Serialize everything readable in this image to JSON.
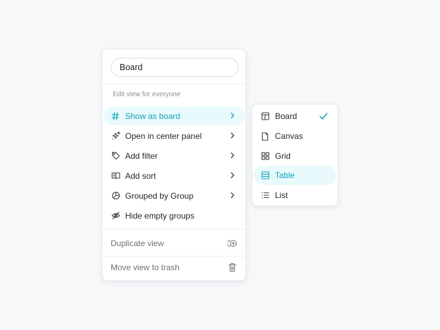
{
  "menu": {
    "name_value": "Board",
    "section_label": "Edit view for everyone",
    "items": [
      {
        "label": "Show as board",
        "icon": "hash-icon",
        "has_submenu": true,
        "active": true
      },
      {
        "label": "Open in center panel",
        "icon": "sparkle-icon",
        "has_submenu": true
      },
      {
        "label": "Add filter",
        "icon": "tag-icon",
        "has_submenu": true
      },
      {
        "label": "Add sort",
        "icon": "book-icon",
        "has_submenu": true
      },
      {
        "label": "Grouped by Group",
        "icon": "pie-chart-icon",
        "has_submenu": true
      },
      {
        "label": "Hide empty groups",
        "icon": "eye-off-icon",
        "has_submenu": false
      }
    ],
    "duplicate_label": "Duplicate view",
    "trash_label": "Move view to trash"
  },
  "submenu": {
    "items": [
      {
        "label": "Board",
        "icon": "board-layout-icon",
        "selected": true
      },
      {
        "label": "Canvas",
        "icon": "document-icon"
      },
      {
        "label": "Grid",
        "icon": "grid-icon"
      },
      {
        "label": "Table",
        "icon": "table-icon",
        "hovered": true
      },
      {
        "label": "List",
        "icon": "list-icon"
      }
    ]
  },
  "colors": {
    "accent": "#14a3b8",
    "active_bg": "#e8fafc",
    "text": "#1f2328",
    "muted": "#6b7078"
  }
}
